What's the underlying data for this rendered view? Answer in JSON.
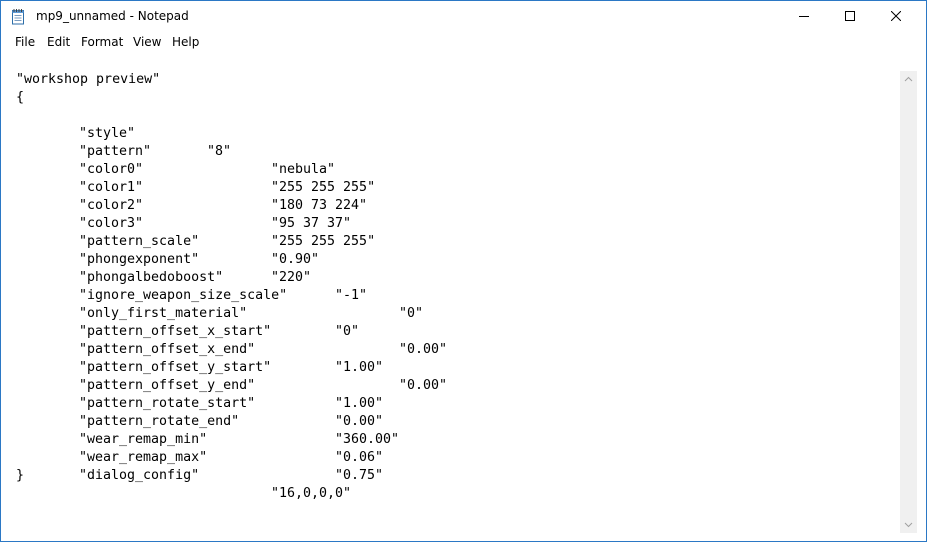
{
  "window": {
    "title": "mp9_unnamed - Notepad",
    "icon": "notepad-icon",
    "controls": [
      "minimize-icon",
      "maximize-icon",
      "close-icon"
    ]
  },
  "menu": {
    "items": [
      {
        "label": "File"
      },
      {
        "label": "Edit"
      },
      {
        "label": "Format"
      },
      {
        "label": "View"
      },
      {
        "label": "Help"
      }
    ]
  },
  "editor": {
    "header": "\"workshop preview\"",
    "open_brace": "{",
    "close_brace": "}",
    "lines": [
      {
        "key": "\"style\"",
        "value": "\"8\""
      },
      {
        "key": "\"pattern\"",
        "value": "\"nebula\""
      },
      {
        "key": "\"color0\"",
        "value": "\"255 255 255\""
      },
      {
        "key": "\"color1\"",
        "value": "\"180 73 224\""
      },
      {
        "key": "\"color2\"",
        "value": "\"95 37 37\""
      },
      {
        "key": "\"color3\"",
        "value": "\"255 255 255\""
      },
      {
        "key": "\"pattern_scale\"",
        "value": "\"0.90\""
      },
      {
        "key": "\"phongexponent\"",
        "value": "\"220\""
      },
      {
        "key": "\"phongalbedoboost\"",
        "value": "\"-1\""
      },
      {
        "key": "\"ignore_weapon_size_scale\"",
        "value": "\"0\""
      },
      {
        "key": "\"only_first_material\"",
        "value": "\"0\""
      },
      {
        "key": "\"pattern_offset_x_start\"",
        "value": "\"0.00\""
      },
      {
        "key": "\"pattern_offset_x_end\"",
        "value": "\"1.00\""
      },
      {
        "key": "\"pattern_offset_y_start\"",
        "value": "\"0.00\""
      },
      {
        "key": "\"pattern_offset_y_end\"",
        "value": "\"1.00\""
      },
      {
        "key": "\"pattern_rotate_start\"",
        "value": "\"0.00\""
      },
      {
        "key": "\"pattern_rotate_end\"",
        "value": "\"360.00\""
      },
      {
        "key": "\"wear_remap_min\"",
        "value": "\"0.06\""
      },
      {
        "key": "\"wear_remap_max\"",
        "value": "\"0.75\""
      },
      {
        "key": "\"dialog_config\"",
        "value": "\"16,0,0,0\""
      }
    ]
  },
  "scrollbar": {
    "up_icon": "scroll-up-arrow-icon",
    "down_icon": "scroll-down-arrow-icon"
  }
}
